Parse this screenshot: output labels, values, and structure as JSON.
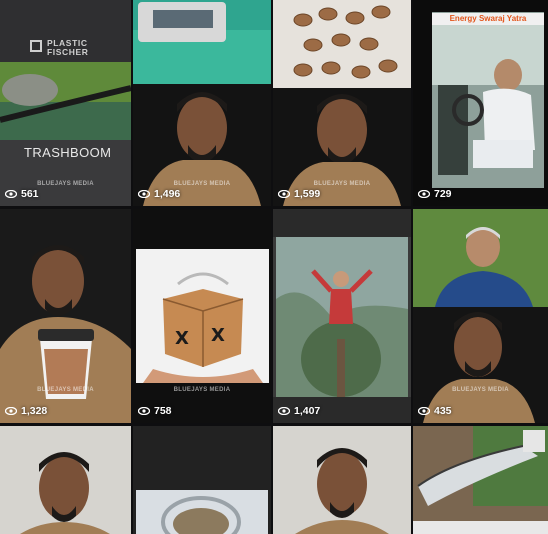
{
  "brand_name_line1": "PLASTIC",
  "brand_name_line2": "FISCHER",
  "tile1_caption": "TRASHBOOM",
  "watermark": "BLUEJAYS MEDIA",
  "banner_title": "Energy Swaraj Yatra",
  "tiles": [
    {
      "views": "561"
    },
    {
      "views": "1,496"
    },
    {
      "views": "1,599"
    },
    {
      "views": "729"
    },
    {
      "views": "1,328"
    },
    {
      "views": "758"
    },
    {
      "views": "1,407"
    },
    {
      "views": "435"
    }
  ]
}
